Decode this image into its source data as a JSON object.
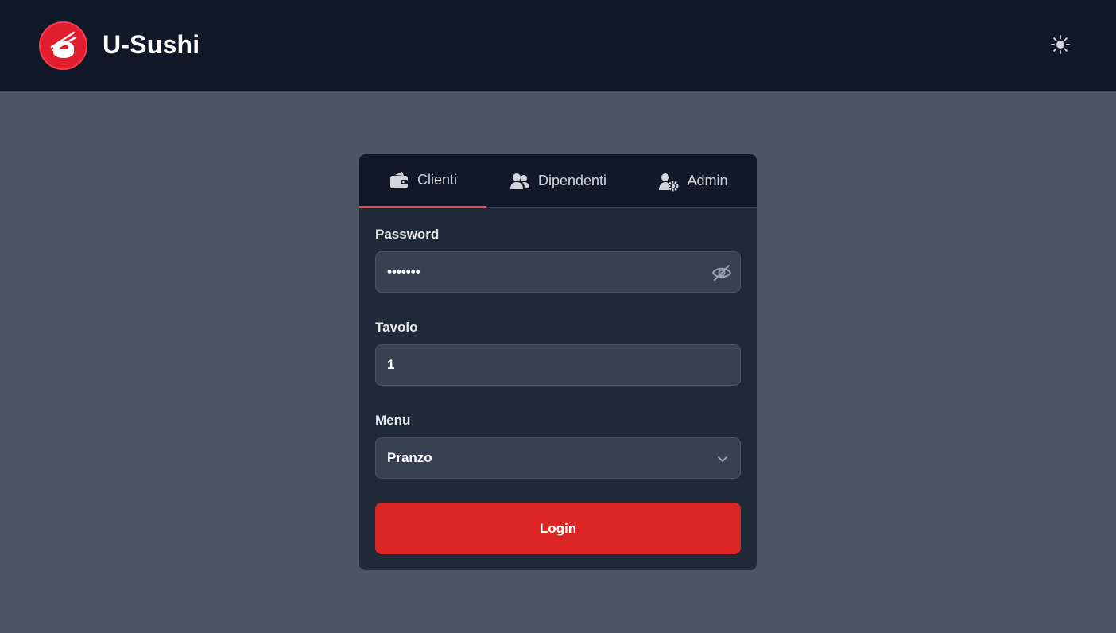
{
  "header": {
    "brand": "U-Sushi",
    "logo_icon": "sushi-chopsticks-icon",
    "theme_icon": "sun-icon"
  },
  "tabs": [
    {
      "label": "Clienti",
      "icon": "wallet-icon",
      "active": true
    },
    {
      "label": "Dipendenti",
      "icon": "users-icon",
      "active": false
    },
    {
      "label": "Admin",
      "icon": "user-gear-icon",
      "active": false
    }
  ],
  "form": {
    "password": {
      "label": "Password",
      "value": "•••••••",
      "toggle_icon": "eye-slash-icon"
    },
    "tavolo": {
      "label": "Tavolo",
      "value": "1"
    },
    "menu": {
      "label": "Menu",
      "selected": "Pranzo",
      "icon": "chevron-down-icon"
    },
    "login_label": "Login"
  },
  "colors": {
    "accent": "#dc2626",
    "header_bg": "#111827",
    "page_bg": "#4b5563",
    "card_bg": "#1f2937"
  }
}
